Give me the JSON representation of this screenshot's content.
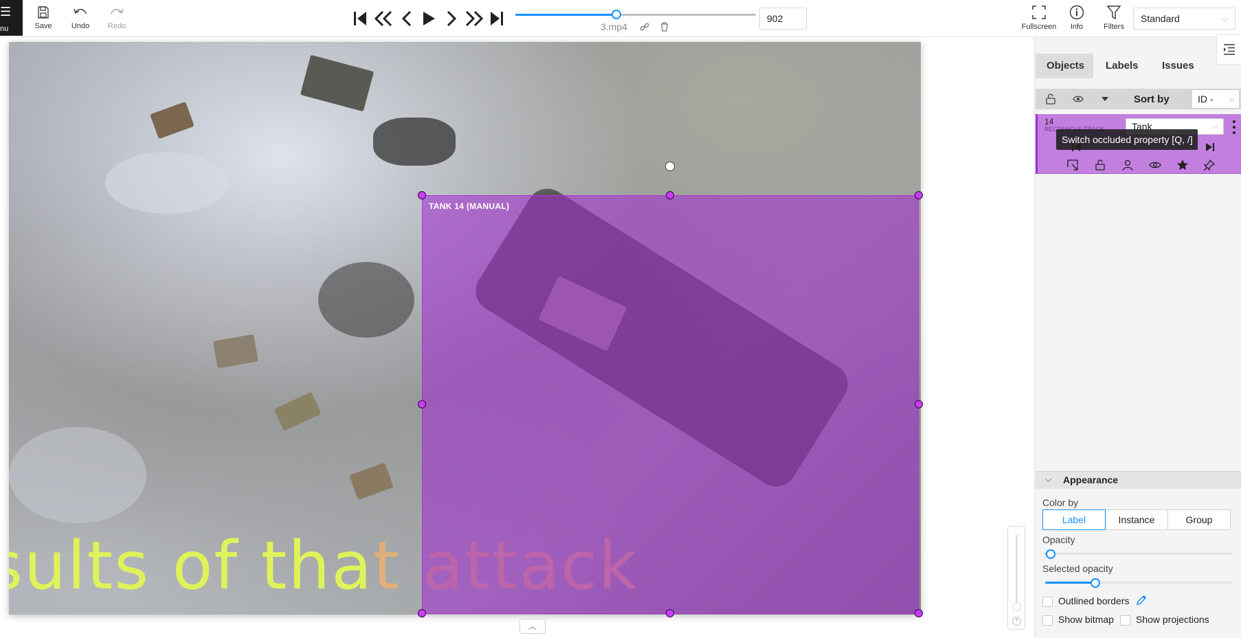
{
  "toolbar": {
    "menu_label": "nu",
    "save_label": "Save",
    "undo_label": "Undo",
    "redo_label": "Redo"
  },
  "player": {
    "frame_number": "902",
    "frame_progress": 0.42,
    "filename": "3.mp4"
  },
  "top_right": {
    "fullscreen_label": "Fullscreen",
    "info_label": "Info",
    "filters_label": "Filters",
    "workspace": "Standard"
  },
  "canvas": {
    "subtitle_green_1": "sults of tha",
    "subtitle_orange": "t attack",
    "bbox_label": "TANK 14 (MANUAL)",
    "bbox_color": "#a028d2"
  },
  "sidebar": {
    "tabs": [
      "Objects",
      "Labels",
      "Issues"
    ],
    "active_tab": "Objects",
    "sort_by_label": "Sort by",
    "sort_value": "ID - ascent",
    "object": {
      "id": "14",
      "type": "RECTANGLE TRACK",
      "label": "Tank",
      "color": "#c27fe0"
    },
    "tooltip": "Switch occluded property [Q, /]",
    "appearance": {
      "title": "Appearance",
      "color_by_label": "Color by",
      "color_by_options": [
        "Label",
        "Instance",
        "Group"
      ],
      "color_by_selected": "Label",
      "opacity_label": "Opacity",
      "opacity_value": 0.03,
      "selected_opacity_label": "Selected opacity",
      "selected_opacity_value": 0.27,
      "outlined_borders_label": "Outlined borders",
      "show_bitmap_label": "Show bitmap",
      "show_projections_label": "Show projections"
    }
  }
}
